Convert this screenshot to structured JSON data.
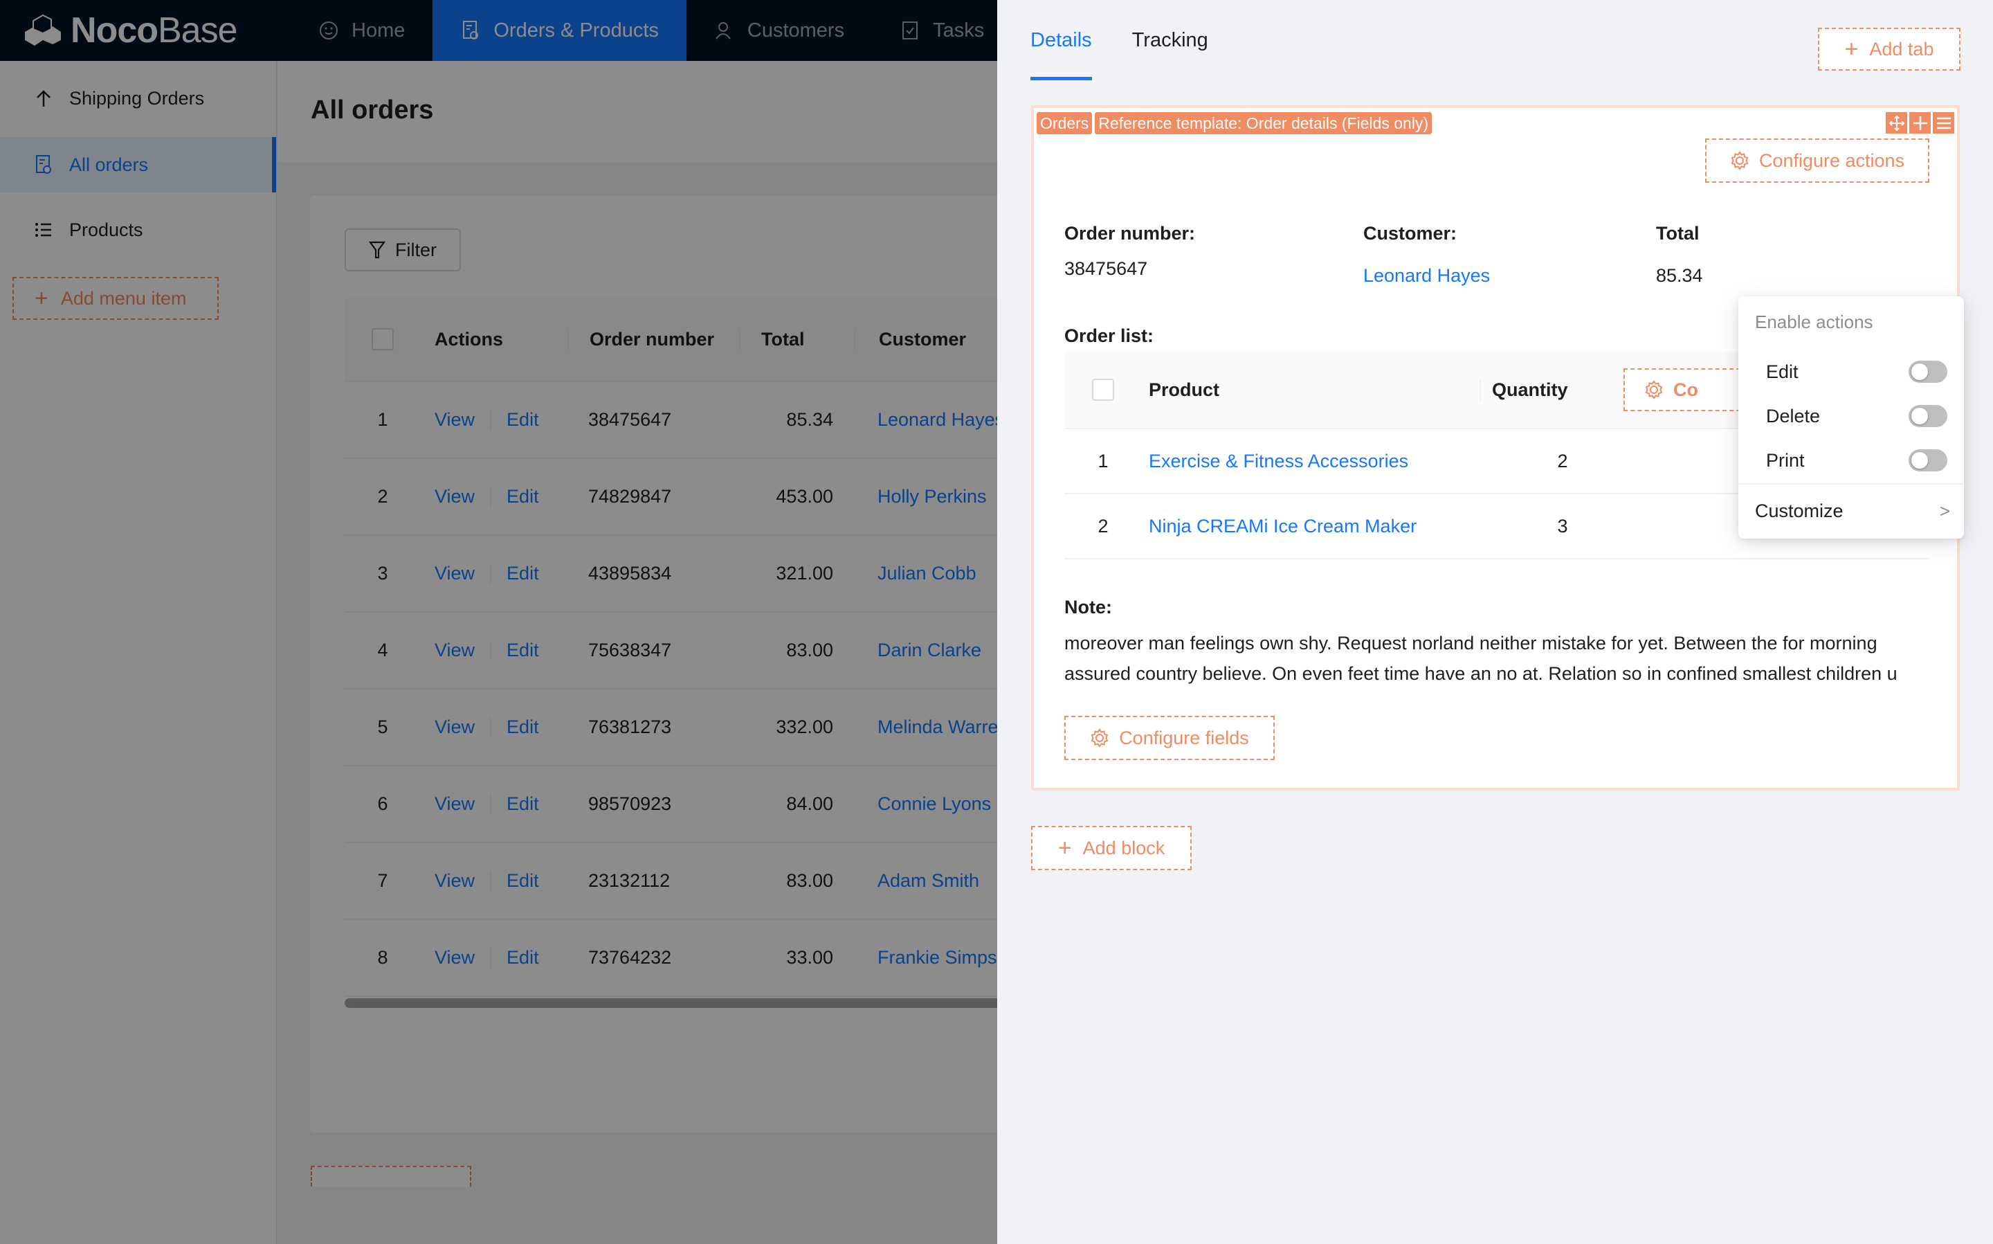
{
  "header": {
    "logo_bold": "Noco",
    "logo_light": "Base",
    "nav": [
      {
        "label": "Home",
        "icon": "smile-icon"
      },
      {
        "label": "Orders & Products",
        "icon": "order-file-icon",
        "active": true
      },
      {
        "label": "Customers",
        "icon": "users-icon"
      },
      {
        "label": "Tasks",
        "icon": "checkbox-icon"
      }
    ]
  },
  "sidebar": {
    "items": [
      {
        "label": "Shipping Orders",
        "icon": "arrow-up-icon"
      },
      {
        "label": "All orders",
        "icon": "order-file-icon",
        "active": true
      },
      {
        "label": "Products",
        "icon": "list-icon"
      }
    ],
    "add_menu_label": "Add menu item"
  },
  "page": {
    "title": "All orders",
    "filter_label": "Filter",
    "table": {
      "columns": [
        "Actions",
        "Order number",
        "Total",
        "Customer"
      ],
      "action_view": "View",
      "action_edit": "Edit",
      "rows": [
        {
          "index": "1",
          "order_number": "38475647",
          "total": "85.34",
          "customer": "Leonard Hayes"
        },
        {
          "index": "2",
          "order_number": "74829847",
          "total": "453.00",
          "customer": "Holly Perkins"
        },
        {
          "index": "3",
          "order_number": "43895834",
          "total": "321.00",
          "customer": "Julian Cobb"
        },
        {
          "index": "4",
          "order_number": "75638347",
          "total": "83.00",
          "customer": "Darin Clarke"
        },
        {
          "index": "5",
          "order_number": "76381273",
          "total": "332.00",
          "customer": "Melinda Warren"
        },
        {
          "index": "6",
          "order_number": "98570923",
          "total": "84.00",
          "customer": "Connie Lyons"
        },
        {
          "index": "7",
          "order_number": "23132112",
          "total": "83.00",
          "customer": "Adam Smith"
        },
        {
          "index": "8",
          "order_number": "73764232",
          "total": "33.00",
          "customer": "Frankie Simpson"
        }
      ]
    }
  },
  "drawer": {
    "tabs": [
      {
        "label": "Details",
        "active": true
      },
      {
        "label": "Tracking"
      }
    ],
    "add_tab_label": "Add tab",
    "block": {
      "tags": [
        "Orders",
        "Reference template: Order details (Fields only)"
      ],
      "configure_actions_label": "Configure actions",
      "fields": {
        "order_number_label": "Order number:",
        "order_number_value": "38475647",
        "customer_label": "Customer:",
        "customer_value": "Leonard Hayes",
        "total_label": "Total",
        "total_value": "85.34"
      },
      "order_list": {
        "label": "Order list:",
        "columns": [
          "Product",
          "Quantity"
        ],
        "configure_label": "Configure columns",
        "configure_visible": "Co",
        "rows": [
          {
            "index": "1",
            "product": "Exercise & Fitness Accessories",
            "quantity": "2"
          },
          {
            "index": "2",
            "product": "Ninja CREAMi Ice Cream Maker",
            "quantity": "3"
          }
        ]
      },
      "note": {
        "label": "Note:",
        "line1": "moreover man feelings own shy. Request norland neither mistake for yet. Between the for morning",
        "line2": "assured country believe. On even feet time have an no at. Relation so in confined smallest children u"
      },
      "configure_fields_label": "Configure fields"
    },
    "add_block_label": "Add block",
    "popover": {
      "group_label": "Enable actions",
      "items": [
        {
          "label": "Edit",
          "enabled": false
        },
        {
          "label": "Delete",
          "enabled": false
        },
        {
          "label": "Print",
          "enabled": false
        }
      ],
      "customize_label": "Customize"
    }
  },
  "colors": {
    "primary": "#1677ff",
    "design_accent": "#f18b62",
    "header_bg": "#001529",
    "annotation_arrow": "#e8202a"
  }
}
